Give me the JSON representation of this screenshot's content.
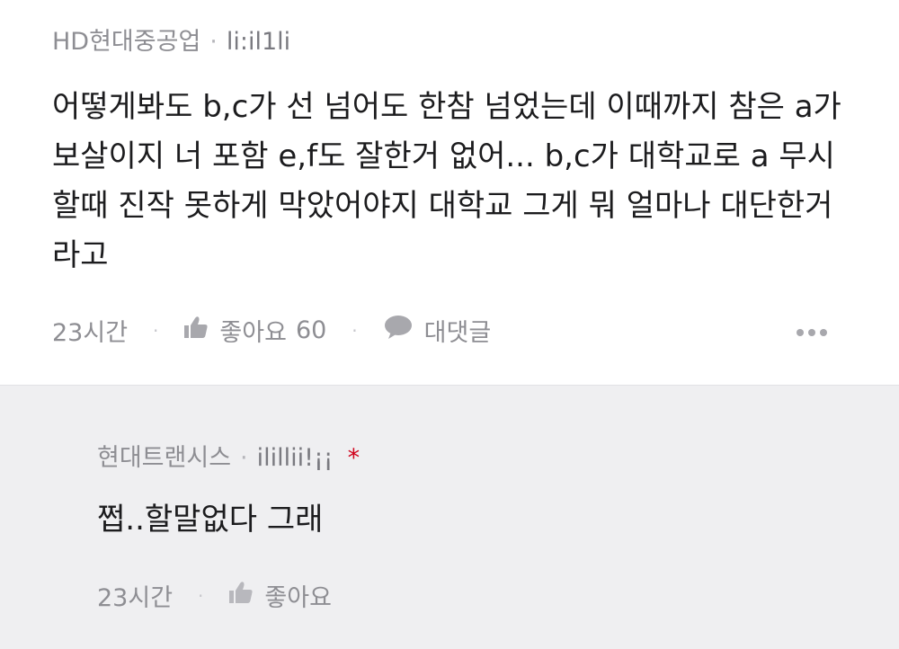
{
  "comment": {
    "company": "HD현대중공업",
    "dot": "·",
    "nickname": "li:il1li",
    "body": "어떻게봐도 b,c가 선 넘어도 한참 넘었는데 이때까지 참은 a가 보살이지 너 포함 e,f도 잘한거 없어... b,c가 대학교로 a 무시할때 진작 못하게 막았어야지 대학교 그게 뭐 얼마나 대단한거라고",
    "time": "23시간",
    "like_label": "좋아요",
    "like_count": "60",
    "reply_label": "대댓글",
    "icons": {
      "like": "thumbs-up-icon",
      "reply": "speech-bubble-icon",
      "more": "more-dots-icon"
    }
  },
  "reply": {
    "company": "현대트랜시스",
    "dot": "·",
    "nickname": "ilillii!¡¡",
    "star": "*",
    "body": "쩝..할말없다 그래",
    "time": "23시간",
    "like_label": "좋아요"
  },
  "colors": {
    "reply_background": "#efeff1",
    "star": "#d0021b",
    "muted_text": "#8e8e93"
  }
}
